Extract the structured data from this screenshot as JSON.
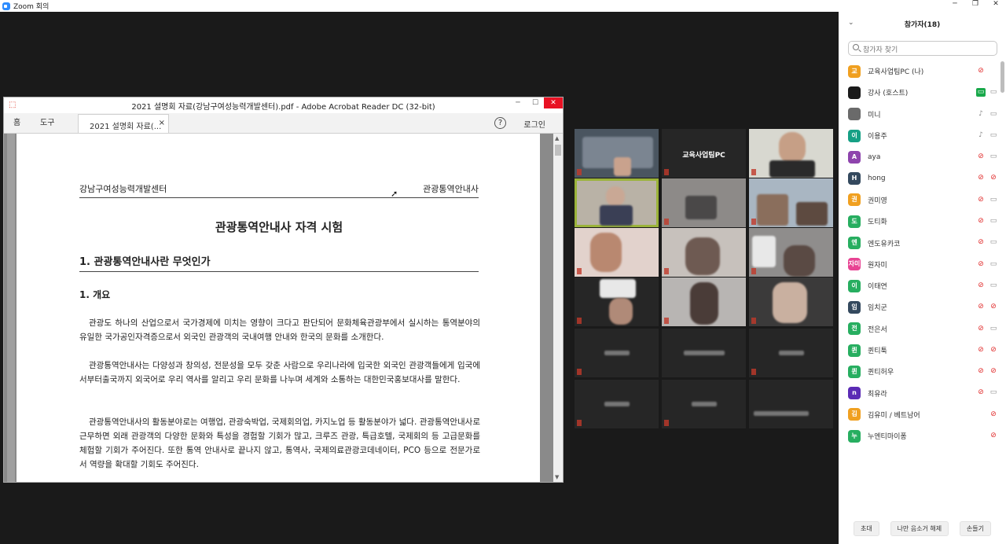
{
  "zoom": {
    "title": "Zoom 회의"
  },
  "acrobat": {
    "title": "2021 설명회 자료(강남구여성능력개발센터).pdf - Adobe Acrobat Reader DC (32-bit)",
    "nav_home": "홈",
    "nav_tools": "도구",
    "doc_tab": "2021 설명회 자료(...",
    "help": "?",
    "login": "로그인",
    "window_controls": [
      "─",
      "☐",
      "✕"
    ]
  },
  "document": {
    "header_left": "강남구여성능력개발센터",
    "header_right": "관광통역안내사",
    "title": "관광통역안내사 자격 시험",
    "section1": "1. 관광통역안내사란 무엇인가",
    "subsection": "1. 개요",
    "paragraphs": [
      "관광도 하나의 산업으로서 국가경제에 미치는 영향이 크다고 판단되어 문화체육관광부에서 실시하는 통역분야의 유일한 국가공인자격증으로서 외국인 관광객의 국내여행 안내와 한국의 문화를 소개한다.",
      "관광통역안내사는 다양성과 창의성, 전문성을 모두 갖춘 사람으로 우리나라에 입국한 외국인 관광객들에게 입국에서부터출국까지 외국어로 우리 역사를 알리고 우리 문화를 나누며 세계와 소통하는 대한민국홍보대사를 말한다.",
      "관광통역안내사의 활동분야로는 여행업, 관광숙박업, 국제회의업, 카지노업 등 활동분야가 넓다. 관광통역안내사로 근무하면 외래 관광객의 다양한 문화와 특성을 경험할 기회가 많고, 크루즈 관광, 특급호텔, 국제회의 등 고급문화를 체험할 기회가 주어진다. 또한 통역 안내사로 끝나지 않고, 통역사, 국제의료관광코데네이터, PCO 등으로 전문가로서 역량을 확대할 기회도 주어진다."
    ]
  },
  "video_grid": {
    "named_tile": "교육사업팀PC"
  },
  "participants": {
    "title": "참가자(18)",
    "search_placeholder": "참가자 찾기",
    "list": [
      {
        "name": "교육사업팀PC (나)",
        "avatar": "교",
        "color": "#f0a020",
        "mic": "muted",
        "cam": "none"
      },
      {
        "name": "강사 (호스트)",
        "avatar": "",
        "color": "#1a1a1a",
        "mic": "none",
        "cam": "on"
      },
      {
        "name": "미니",
        "avatar": "",
        "color": "#6a6a6a",
        "mic": "on",
        "cam": "off"
      },
      {
        "name": "이용주",
        "avatar": "이",
        "color": "#16a085",
        "mic": "on",
        "cam": "off"
      },
      {
        "name": "aya",
        "avatar": "A",
        "color": "#8e44ad",
        "mic": "muted",
        "cam": "off"
      },
      {
        "name": "hong",
        "avatar": "H",
        "color": "#34495e",
        "mic": "muted",
        "cam": "muted"
      },
      {
        "name": "권미영",
        "avatar": "권",
        "color": "#f0a020",
        "mic": "muted",
        "cam": "off"
      },
      {
        "name": "도티화",
        "avatar": "도",
        "color": "#27ae60",
        "mic": "muted",
        "cam": "off"
      },
      {
        "name": "엔도유카코",
        "avatar": "엔",
        "color": "#27ae60",
        "mic": "muted",
        "cam": "off"
      },
      {
        "name": "원자미",
        "avatar": "자미",
        "color": "#e84393",
        "mic": "muted",
        "cam": "off"
      },
      {
        "name": "이태연",
        "avatar": "이",
        "color": "#27ae60",
        "mic": "muted",
        "cam": "off"
      },
      {
        "name": "임치군",
        "avatar": "임",
        "color": "#34495e",
        "mic": "muted",
        "cam": "muted"
      },
      {
        "name": "전은서",
        "avatar": "전",
        "color": "#27ae60",
        "mic": "muted",
        "cam": "off"
      },
      {
        "name": "퀸티툭",
        "avatar": "퀸",
        "color": "#27ae60",
        "mic": "muted",
        "cam": "muted"
      },
      {
        "name": "퀸티허우",
        "avatar": "퀸",
        "color": "#27ae60",
        "mic": "muted",
        "cam": "muted"
      },
      {
        "name": "최유라",
        "avatar": "n",
        "color": "#5b2bb5",
        "mic": "muted",
        "cam": "off"
      },
      {
        "name": "김유미 / 베트남어",
        "avatar": "김",
        "color": "#f0a020",
        "mic": "none",
        "cam": "muted"
      },
      {
        "name": "누엔티마이퐁",
        "avatar": "누",
        "color": "#27ae60",
        "mic": "none",
        "cam": "muted"
      }
    ],
    "footer": {
      "invite": "초대",
      "unmute_me": "나만 음소거 해제",
      "raise_hand": "손들기"
    }
  }
}
